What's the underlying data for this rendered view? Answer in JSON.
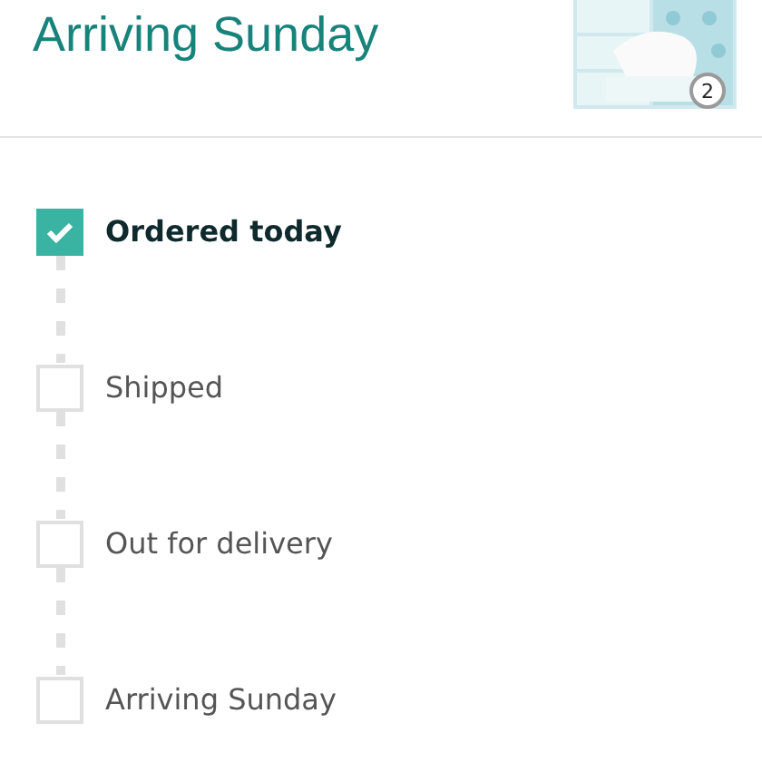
{
  "header": {
    "title": "Arriving Sunday",
    "product": {
      "kind": "picture",
      "quantity": "2"
    }
  },
  "steps": [
    {
      "label": "Ordered today",
      "checked": true
    },
    {
      "label": "Shipped",
      "checked": false
    },
    {
      "label": "Out for delivery",
      "checked": false
    },
    {
      "label": "Arriving Sunday",
      "checked": false
    }
  ]
}
